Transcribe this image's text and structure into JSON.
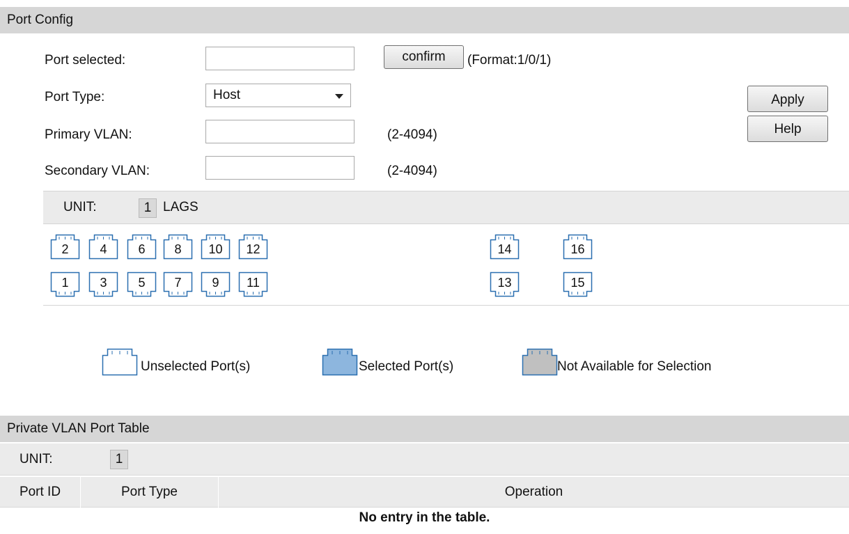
{
  "port_config": {
    "title": "Port Config",
    "port_selected_label": "Port selected:",
    "port_selected_value": "",
    "confirm_label": "confirm",
    "format_hint": "(Format:1/0/1)",
    "port_type_label": "Port Type:",
    "port_type_value": "Host",
    "primary_vlan_label": "Primary VLAN:",
    "primary_vlan_value": "",
    "primary_vlan_range": "(2-4094)",
    "secondary_vlan_label": "Secondary VLAN:",
    "secondary_vlan_value": "",
    "secondary_vlan_range": "(2-4094)",
    "apply_label": "Apply",
    "help_label": "Help"
  },
  "unit_selector": {
    "unit_label": "UNIT:",
    "unit_value": "1",
    "lags_label": "LAGS"
  },
  "ports": {
    "top_row": [
      "2",
      "4",
      "6",
      "8",
      "10",
      "12",
      "14",
      "16"
    ],
    "bottom_row": [
      "1",
      "3",
      "5",
      "7",
      "9",
      "11",
      "13",
      "15"
    ]
  },
  "legend": {
    "unselected": "Unselected Port(s)",
    "selected": "Selected Port(s)",
    "not_available": "Not Available for Selection",
    "colors": {
      "unselected": "#ffffff",
      "selected": "#8db6de",
      "not_available": "#c0c0c0",
      "port_outline": "#2a6fb0"
    }
  },
  "pvlan_table": {
    "title": "Private VLAN Port Table",
    "unit_label": "UNIT:",
    "unit_value": "1",
    "columns": [
      "Port ID",
      "Port Type",
      "Operation"
    ],
    "empty_message": "No entry in the table."
  }
}
